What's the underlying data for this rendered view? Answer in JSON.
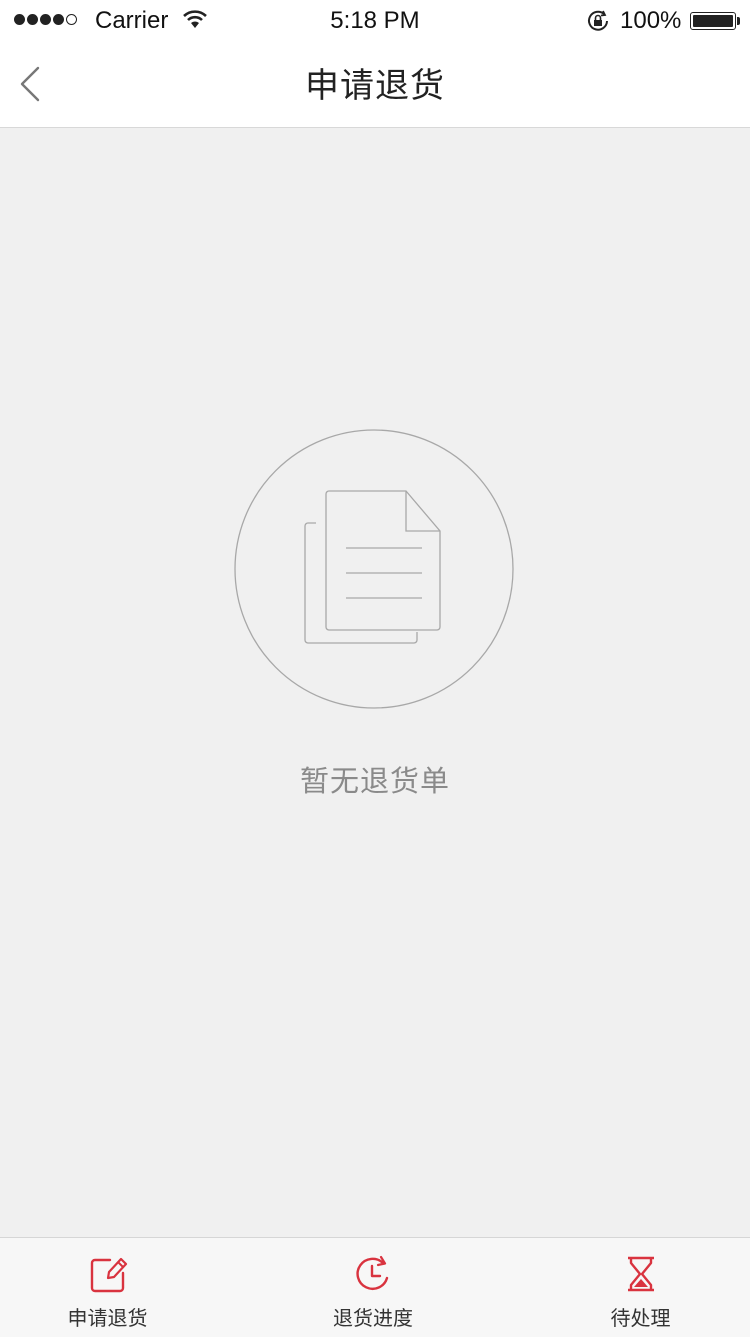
{
  "status_bar": {
    "carrier": "Carrier",
    "time": "5:18 PM",
    "battery": "100%",
    "signal_bars": 4,
    "icons": [
      "wifi-icon",
      "orientation-lock-icon",
      "battery-icon"
    ]
  },
  "nav": {
    "title": "申请退货",
    "back_icon": "chevron-left-icon"
  },
  "empty": {
    "icon": "documents-icon",
    "message": "暂无退货单"
  },
  "tabs": [
    {
      "label": "申请退货",
      "icon": "edit-square-icon"
    },
    {
      "label": "退货进度",
      "icon": "clock-refresh-icon"
    },
    {
      "label": "待处理",
      "icon": "hourglass-icon"
    }
  ],
  "colors": {
    "accent": "#d9333f",
    "background": "#f0f0f0",
    "nav_background": "#ffffff",
    "muted_text": "#8a8a8a"
  }
}
